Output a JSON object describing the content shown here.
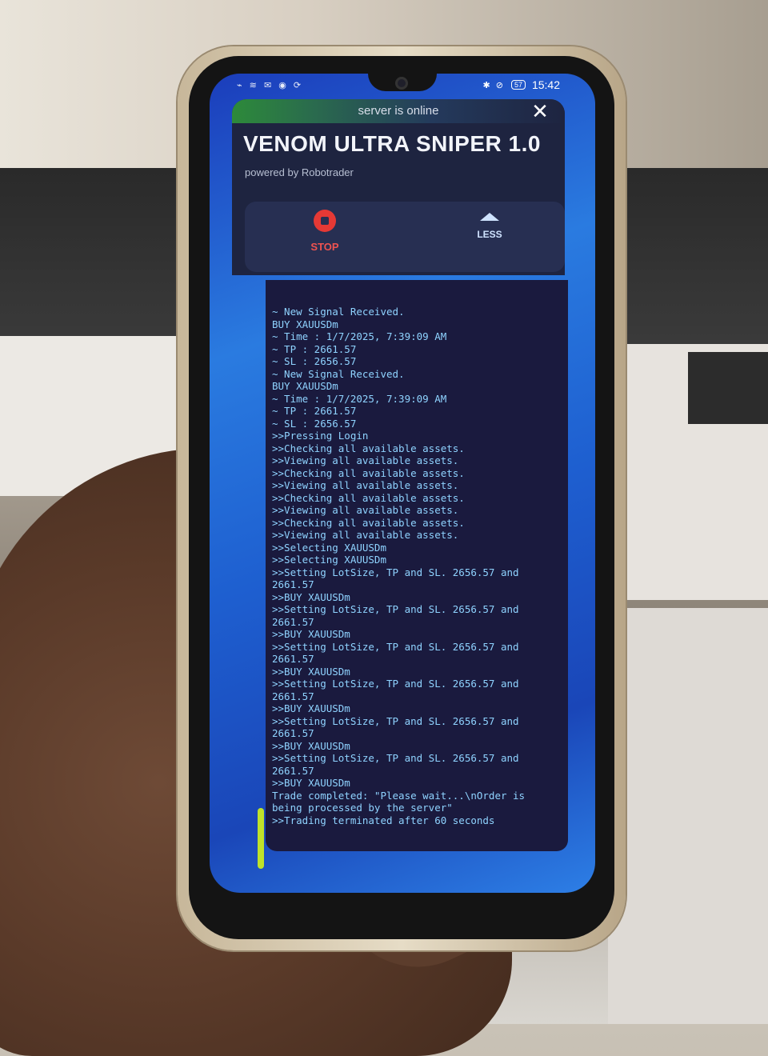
{
  "status_bar": {
    "left_icons": "⌁ ≋ ✉ ◉ ⟳",
    "right_icons": "✱ ⊘",
    "battery": "57",
    "time": "15:42"
  },
  "app": {
    "server_status": "server is online",
    "close_label": "✕",
    "title": "VENOM ULTRA SNIPER 1.0",
    "subtitle": "powered by Robotrader"
  },
  "controls": {
    "stop_label": "STOP",
    "less_label": "LESS"
  },
  "log": [
    "~ New Signal Received.",
    "BUY XAUUSDm",
    "~ Time : 1/7/2025, 7:39:09 AM",
    "~ TP : 2661.57",
    "~ SL : 2656.57",
    "~ New Signal Received.",
    "BUY XAUUSDm",
    "~ Time : 1/7/2025, 7:39:09 AM",
    "~ TP : 2661.57",
    "~ SL : 2656.57",
    ">>Pressing Login",
    ">>Checking all available assets.",
    ">>Viewing all available assets.",
    ">>Checking all available assets.",
    ">>Viewing all available assets.",
    ">>Checking all available assets.",
    ">>Viewing all available assets.",
    ">>Checking all available assets.",
    ">>Viewing all available assets.",
    ">>Selecting XAUUSDm",
    ">>Selecting XAUUSDm",
    ">>Setting LotSize, TP and SL. 2656.57 and 2661.57",
    ">>BUY XAUUSDm",
    ">>Setting LotSize, TP and SL. 2656.57 and 2661.57",
    ">>BUY XAUUSDm",
    ">>Setting LotSize, TP and SL. 2656.57 and 2661.57",
    ">>BUY XAUUSDm",
    ">>Setting LotSize, TP and SL. 2656.57 and 2661.57",
    ">>BUY XAUUSDm",
    ">>Setting LotSize, TP and SL. 2656.57 and 2661.57",
    ">>BUY XAUUSDm",
    ">>Setting LotSize, TP and SL. 2656.57 and 2661.57",
    ">>BUY XAUUSDm",
    "Trade completed: \"Please wait...\\nOrder is being processed by the server\"",
    ">>Trading terminated after 60 seconds"
  ],
  "colors": {
    "accent_stop": "#e53935",
    "server_online": "#2d8a3a",
    "log_text": "#8fd3ff"
  }
}
